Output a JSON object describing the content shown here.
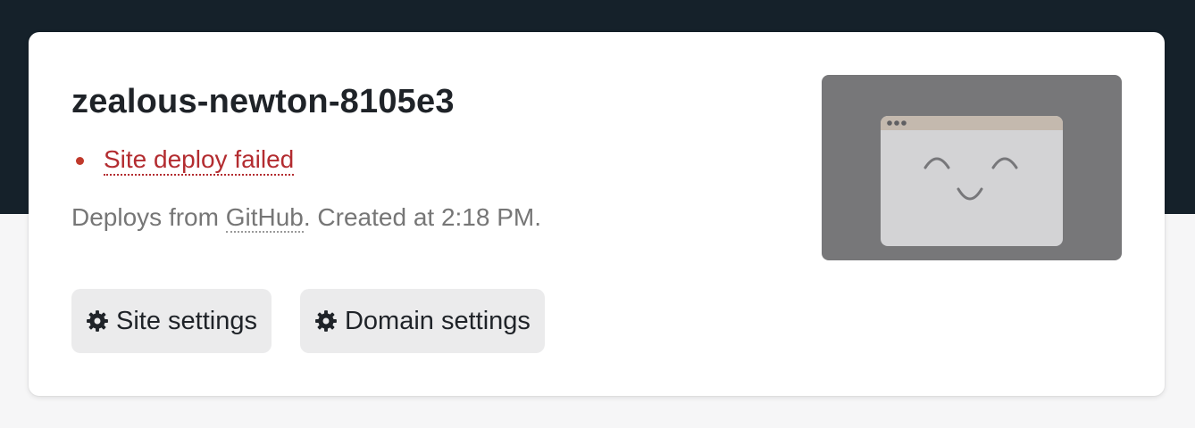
{
  "site": {
    "name": "zealous-newton-8105e3",
    "status": "Site deploy failed",
    "info_prefix": "Deploys from ",
    "info_source": "GitHub",
    "info_suffix": ". Created at 2:18 PM."
  },
  "actions": {
    "site_settings": "Site settings",
    "domain_settings": "Domain settings"
  },
  "icons": {
    "status": "dot-icon",
    "settings": "gear-icon",
    "preview": "smiling-browser-icon"
  },
  "colors": {
    "header_bg": "#15212a",
    "error": "#b32c30",
    "button_bg": "#ebebec",
    "preview_bg": "#777779"
  }
}
